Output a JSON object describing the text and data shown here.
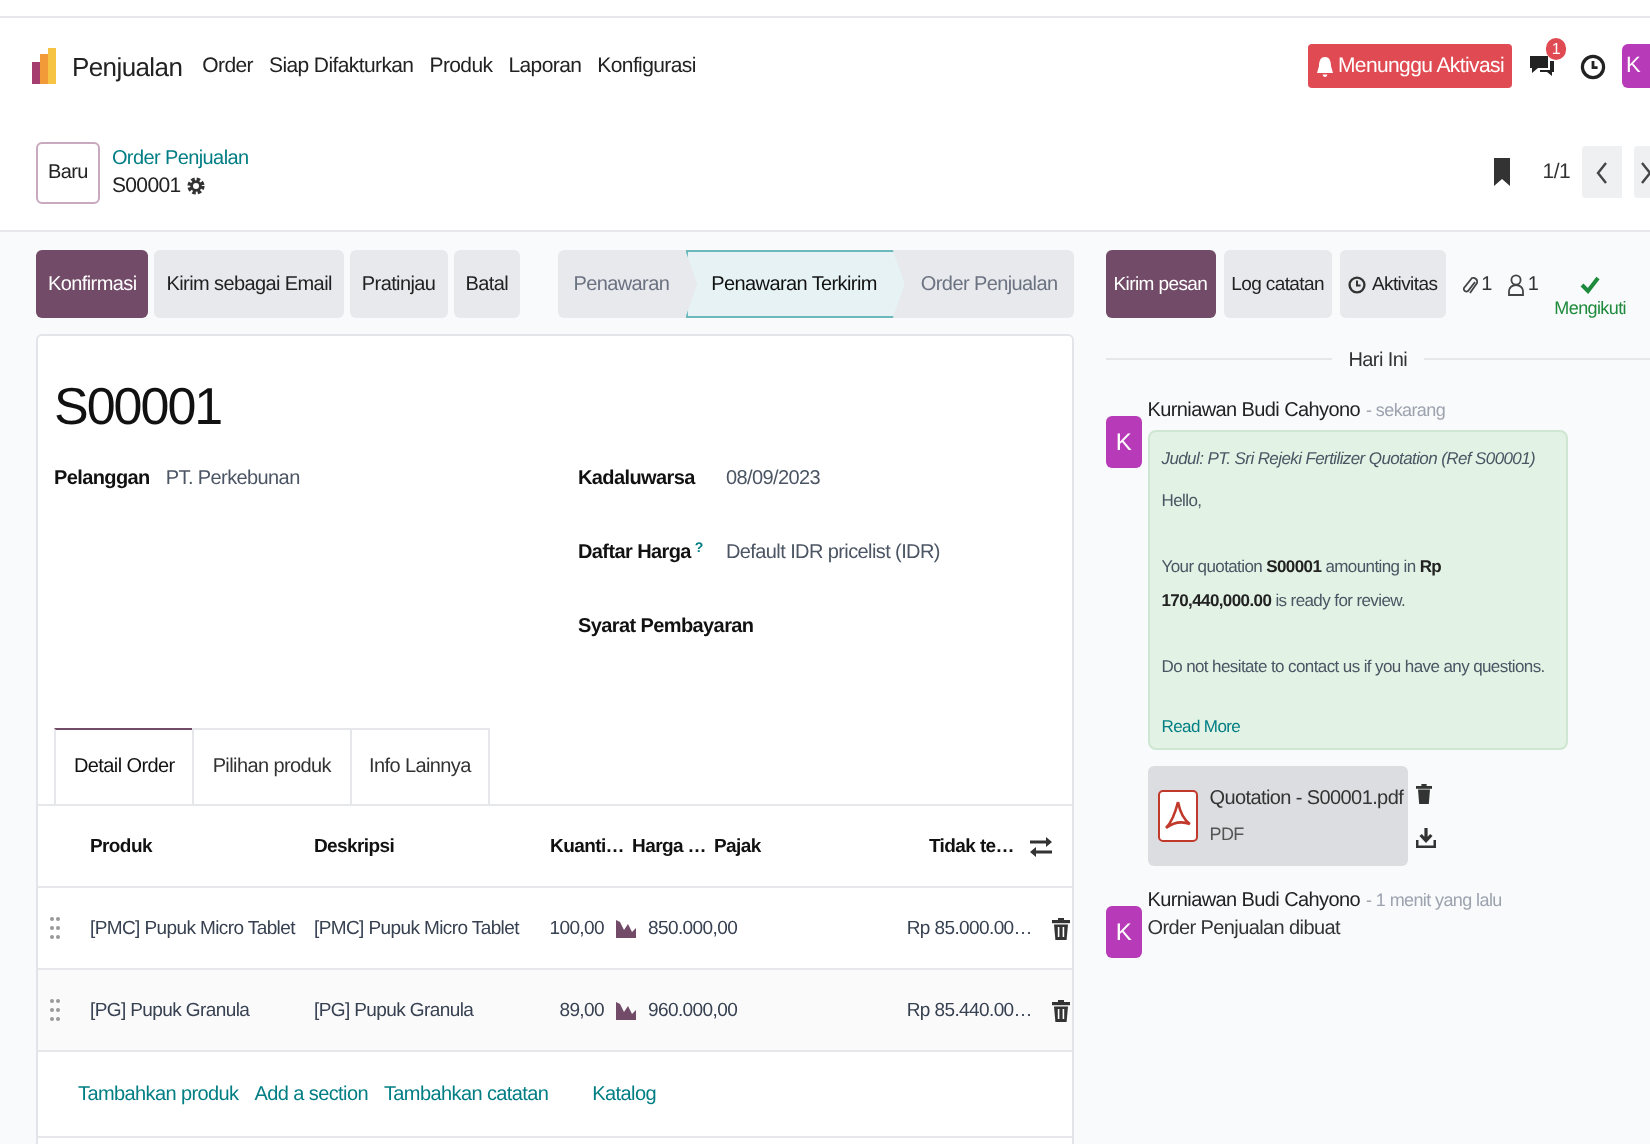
{
  "navbar": {
    "app_name": "Penjualan",
    "menu": [
      {
        "label": "Order"
      },
      {
        "label": "Siap Difakturkan"
      },
      {
        "label": "Produk"
      },
      {
        "label": "Laporan"
      },
      {
        "label": "Konfigurasi"
      }
    ],
    "activation_button": "Menunggu Aktivasi",
    "message_badge": "1",
    "avatar_letter": "K"
  },
  "control_panel": {
    "new_button": "Baru",
    "breadcrumb": "Order Penjualan",
    "record": "S00001",
    "pager": "1/1"
  },
  "action_buttons": [
    {
      "label": "Konfirmasi",
      "primary": true
    },
    {
      "label": "Kirim sebagai Email",
      "primary": false
    },
    {
      "label": "Pratinjau",
      "primary": false
    },
    {
      "label": "Batal",
      "primary": false
    }
  ],
  "status_bar": [
    {
      "label": "Penawaran",
      "selected": false
    },
    {
      "label": "Penawaran Terkirim",
      "selected": true
    },
    {
      "label": "Order Penjualan",
      "selected": false
    }
  ],
  "chatter_buttons": [
    {
      "label": "Kirim pesan",
      "primary": true,
      "kind": "plain"
    },
    {
      "label": "Log catatan",
      "primary": false,
      "kind": "plain"
    },
    {
      "label": "Aktivitas",
      "primary": false,
      "kind": "clock"
    }
  ],
  "chatter_counts": {
    "attachments": "1",
    "followers": "1",
    "follow_label": "Mengikuti"
  },
  "form": {
    "title": "S00001",
    "fields_left": [
      {
        "label": "Pelanggan",
        "value": "PT. Perkebunan"
      }
    ],
    "fields_right": [
      {
        "label": "Kadaluwarsa",
        "value": "08/09/2023"
      },
      {
        "label": "Daftar Harga",
        "help": "?",
        "value": "Default IDR pricelist (IDR)"
      },
      {
        "label": "Syarat Pembayaran"
      }
    ],
    "tabs": [
      {
        "label": "Detail Order",
        "selected": true
      },
      {
        "label": "Pilihan produk",
        "selected": false
      },
      {
        "label": "Info Lainnya",
        "selected": false
      }
    ],
    "table": {
      "columns": [
        "Produk",
        "Deskripsi",
        "Kuanti…",
        "Harga …",
        "Pajak",
        "Tidak te…"
      ],
      "rows": [
        {
          "product": "[PMC] Pupuk Micro Tablet",
          "description": "[PMC] Pupuk Micro Tablet",
          "quantity": "100,00",
          "price": "850.000,00",
          "subtotal": "Rp 85.000.00…"
        },
        {
          "product": "[PG] Pupuk Granula",
          "description": "[PG] Pupuk Granula",
          "quantity": "89,00",
          "price": "960.000,00",
          "subtotal": "Rp 85.440.00…"
        }
      ]
    },
    "add_links": [
      "Tambahkan produk",
      "Add a section",
      "Tambahkan catatan",
      "Katalog"
    ]
  },
  "chatter": {
    "date_separator": "Hari Ini",
    "messages": [
      {
        "kind": "email",
        "avatar": "K",
        "author": "Kurniawan Budi Cahyono",
        "time": "- sekarang",
        "subject": "Judul: PT. Sri Rejeki Fertilizer Quotation (Ref S00001)",
        "body": [
          "Hello,",
          "Your quotation **S00001** amounting in **Rp 170,440,000.00** is ready for review.",
          "Do not hesitate to contact us if you have any questions."
        ],
        "read_more": "Read More",
        "attachment": {
          "name": "Quotation - S00001.pdf",
          "type": "PDF"
        }
      },
      {
        "kind": "note",
        "avatar": "K",
        "author": "Kurniawan Budi Cahyono",
        "time": "- 1 menit yang lalu",
        "body": [
          "Order Penjualan dibuat"
        ]
      }
    ]
  }
}
